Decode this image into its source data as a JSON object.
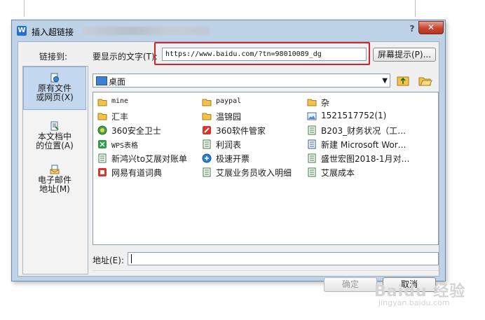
{
  "window": {
    "title": "插入超链接"
  },
  "link_to": {
    "label": "链接到:"
  },
  "display_text": {
    "label": "要显示的文字(T):",
    "value": "https://www.baidu.com/?tn=98010089_dg",
    "screen_tip_button": "屏幕提示(P)..."
  },
  "sidebar": {
    "items": [
      {
        "label_line1": "原有文件",
        "label_line2": "或网页(X)",
        "active": true
      },
      {
        "label_line1": "本文档中",
        "label_line2": "的位置(A)",
        "active": false
      },
      {
        "label_line1": "电子邮件",
        "label_line2": "地址(M)",
        "active": false
      }
    ]
  },
  "look_in": {
    "value": "桌面"
  },
  "files": [
    {
      "name": "mine",
      "icon": "folder-icon",
      "mono": true
    },
    {
      "name": "paypal",
      "icon": "folder-icon",
      "mono": true
    },
    {
      "name": "杂",
      "icon": "folder-icon",
      "mono": false
    },
    {
      "name": "汇丰",
      "icon": "folder-icon",
      "mono": false
    },
    {
      "name": "温锦园",
      "icon": "folder-icon",
      "mono": false
    },
    {
      "name": "1521517752(1)",
      "icon": "image-file-icon",
      "mono": false
    },
    {
      "name": "360安全卫士",
      "icon": "shield-app-icon",
      "mono": false
    },
    {
      "name": "360软件管家",
      "icon": "app-shortcut-icon",
      "mono": false
    },
    {
      "name": "B203_财务状况（工…",
      "icon": "spreadsheet-file-icon",
      "mono": false
    },
    {
      "name": "WPS表格",
      "icon": "spreadsheet-app-icon",
      "mono": false
    },
    {
      "name": "利润表",
      "icon": "spreadsheet-file-icon",
      "mono": false
    },
    {
      "name": "新建 Microsoft Wor…",
      "icon": "document-file-icon",
      "mono": false
    },
    {
      "name": "新鸿兴to艾展对账单",
      "icon": "spreadsheet-file-icon",
      "mono": false
    },
    {
      "name": "极速开票",
      "icon": "invoice-app-icon",
      "mono": false
    },
    {
      "name": "盛世宏图2018-1月对…",
      "icon": "spreadsheet-file-icon",
      "mono": false
    },
    {
      "name": "网易有道词典",
      "icon": "dictionary-app-icon",
      "mono": false
    },
    {
      "name": "艾展业务员收入明细",
      "icon": "spreadsheet-file-icon",
      "mono": false
    },
    {
      "name": "艾展成本",
      "icon": "spreadsheet-file-icon",
      "mono": false
    }
  ],
  "address": {
    "label": "地址(E):",
    "value": ""
  },
  "buttons": {
    "ok": "确定",
    "cancel": "取消"
  },
  "watermark": {
    "brand": "Baidu 经验",
    "url": "jingyan.baidu.com"
  }
}
